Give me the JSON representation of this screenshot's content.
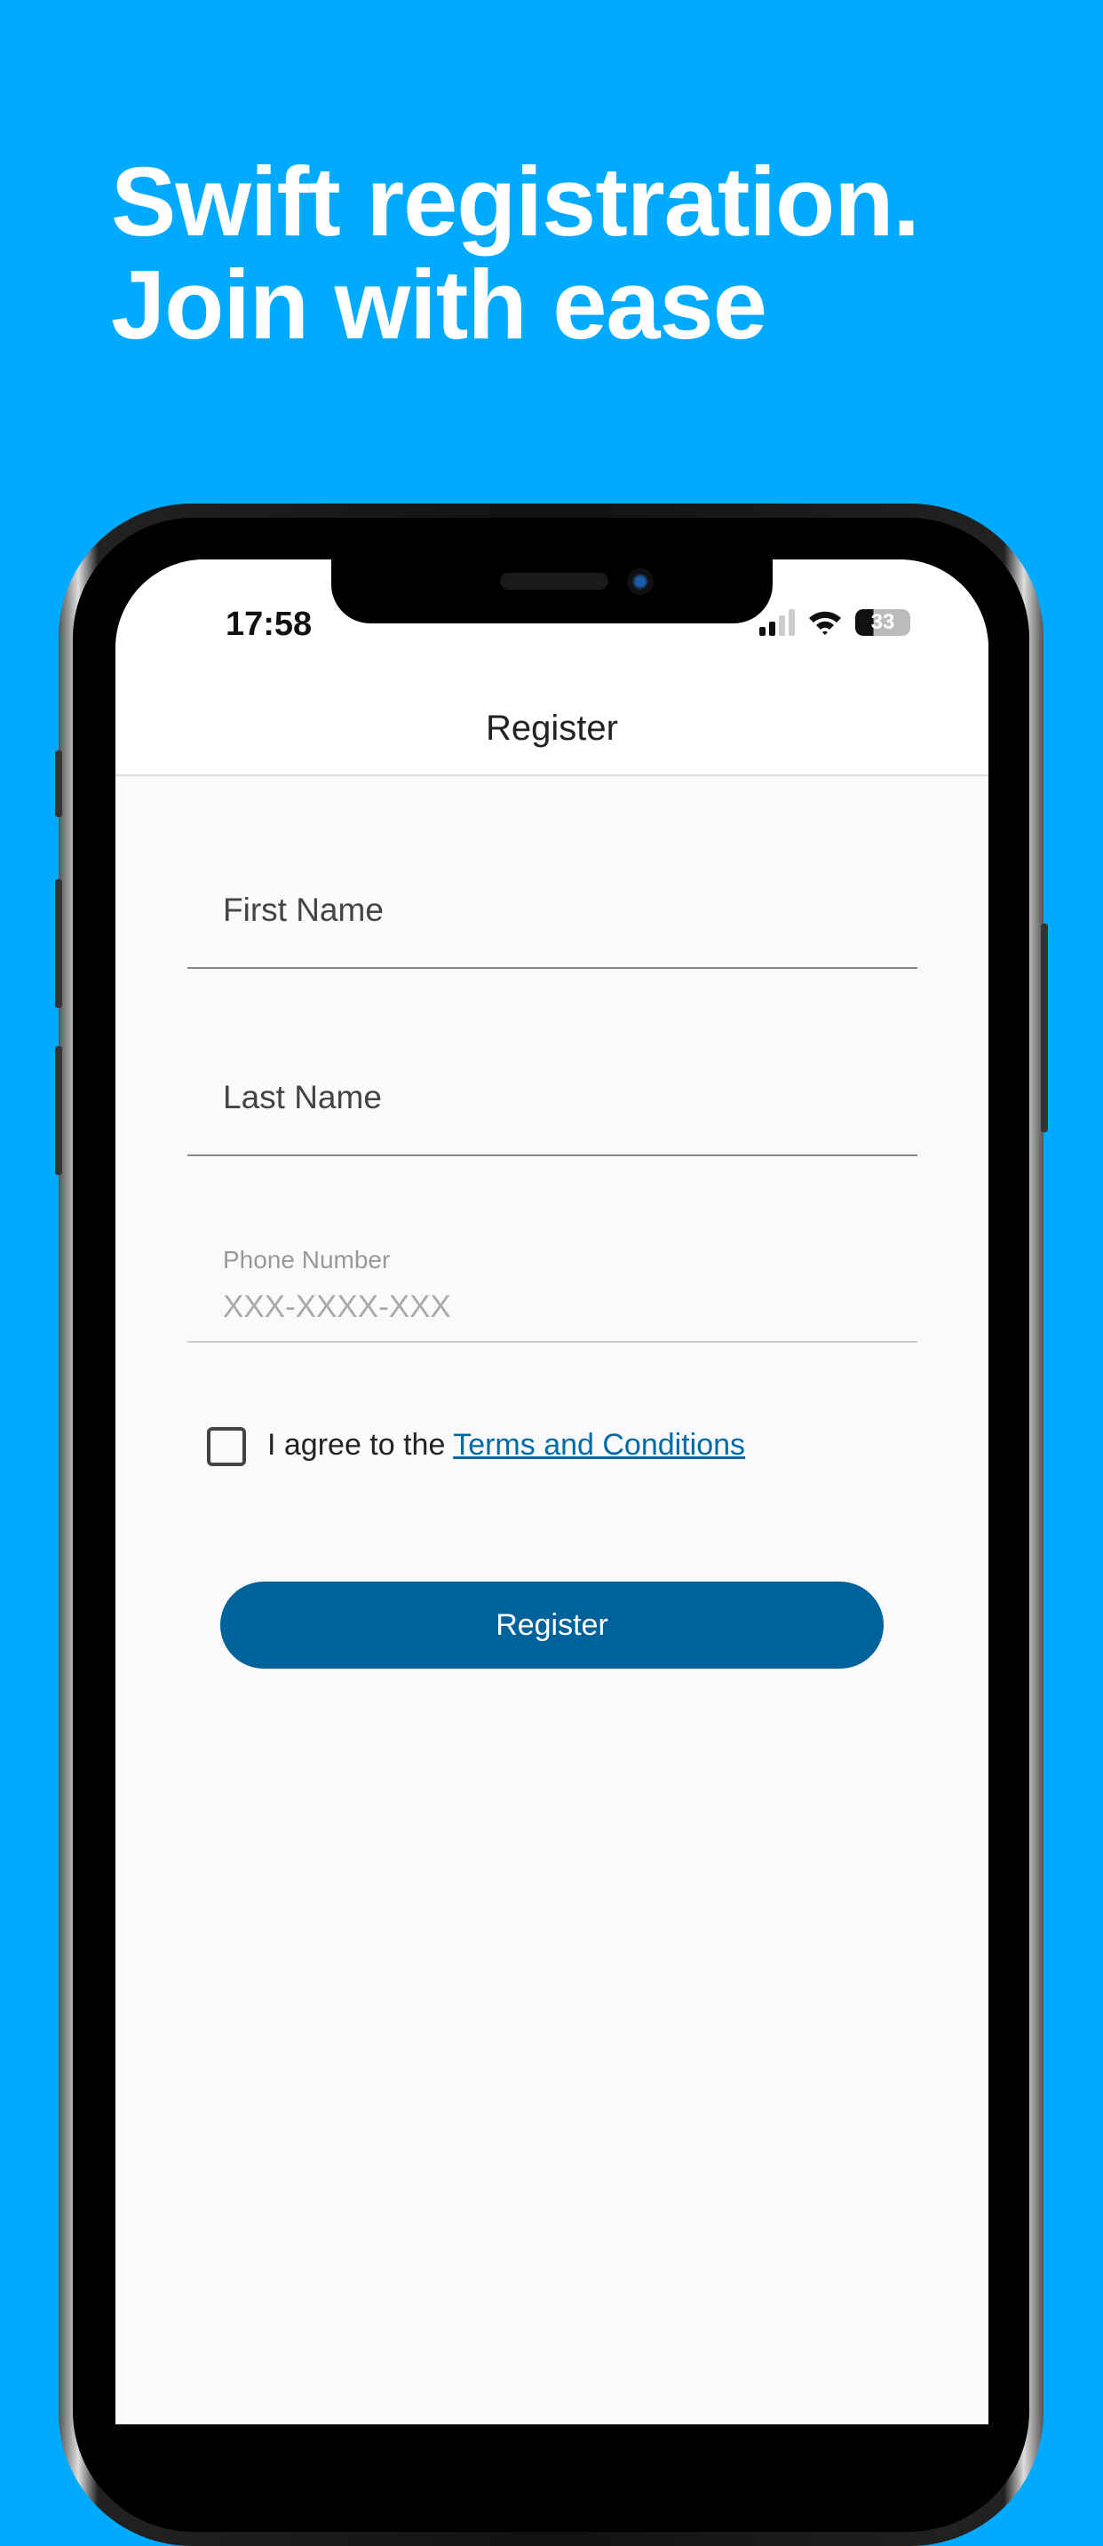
{
  "headline": {
    "line1": "Swift registration.",
    "line2": "Join with ease"
  },
  "status": {
    "time": "17:58",
    "battery": "33"
  },
  "nav": {
    "title": "Register"
  },
  "form": {
    "first_name": "First Name",
    "last_name": "Last Name",
    "phone_label": "Phone Number",
    "phone_placeholder": "XXX-XXXX-XXX",
    "agree_prefix": "I agree to the ",
    "terms_link": "Terms and Conditions",
    "register_label": "Register"
  },
  "colors": {
    "background": "#00aaff",
    "button": "#00629b",
    "link": "#006aa6"
  }
}
